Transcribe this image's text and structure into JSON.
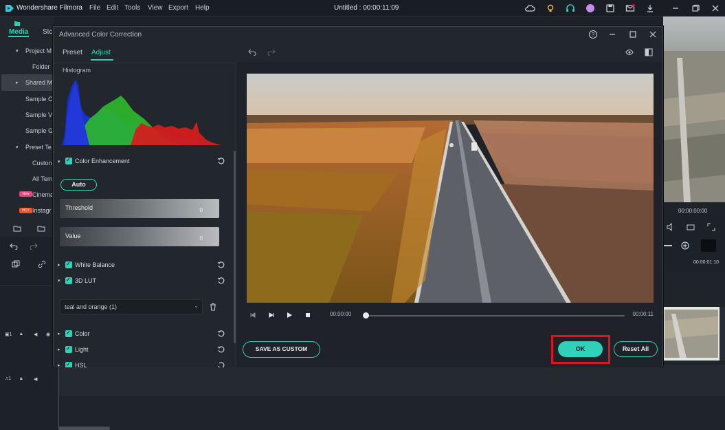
{
  "app": {
    "name": "Wondershare Filmora",
    "menu": [
      "File",
      "Edit",
      "Tools",
      "View",
      "Export",
      "Help"
    ],
    "document_title": "Untitled : 00:00:11:09"
  },
  "left_panel": {
    "media_tab": "Media",
    "stock_tab": "Sto",
    "tree": [
      {
        "label": "Project M",
        "expand": "▾"
      },
      {
        "label": "Folder",
        "expand": ""
      },
      {
        "label": "Shared M",
        "expand": "▸"
      },
      {
        "label": "Sample Co",
        "expand": ""
      },
      {
        "label": "Sample Vi",
        "expand": ""
      },
      {
        "label": "Sample G",
        "expand": ""
      },
      {
        "label": "Preset Te",
        "expand": "▾"
      },
      {
        "label": "Custon",
        "expand": ""
      },
      {
        "label": "All Tem",
        "expand": ""
      },
      {
        "label": "Cinema",
        "badge": "New"
      },
      {
        "label": "Instagr",
        "badge": "HOT"
      }
    ]
  },
  "right_panel": {
    "time_display": "00:00:00:00",
    "ruler_time": "00:00:01:10"
  },
  "dialog": {
    "title": "Advanced Color Correction",
    "tabs": {
      "preset": "Preset",
      "adjust": "Adjust"
    },
    "histogram_label": "Histogram",
    "color_enhancement": "Color Enhancement",
    "auto_button": "Auto",
    "threshold": {
      "label": "Threshold",
      "value": "0"
    },
    "value_slider": {
      "label": "Value",
      "value": "0"
    },
    "white_balance": "White Balance",
    "lut_3d": "3D LUT",
    "lut_selected": "teal and orange (1)",
    "color": "Color",
    "light": "Light",
    "hsl": "HSL",
    "player": {
      "current_time": "00:00:00",
      "end_time": "00:00:11",
      "progress": 0
    },
    "save_as_custom": "SAVE AS CUSTOM",
    "ok": "OK",
    "reset_all": "Reset All"
  },
  "colors": {
    "accent": "#2fd2b9",
    "highlight_box": "#e0141e"
  }
}
